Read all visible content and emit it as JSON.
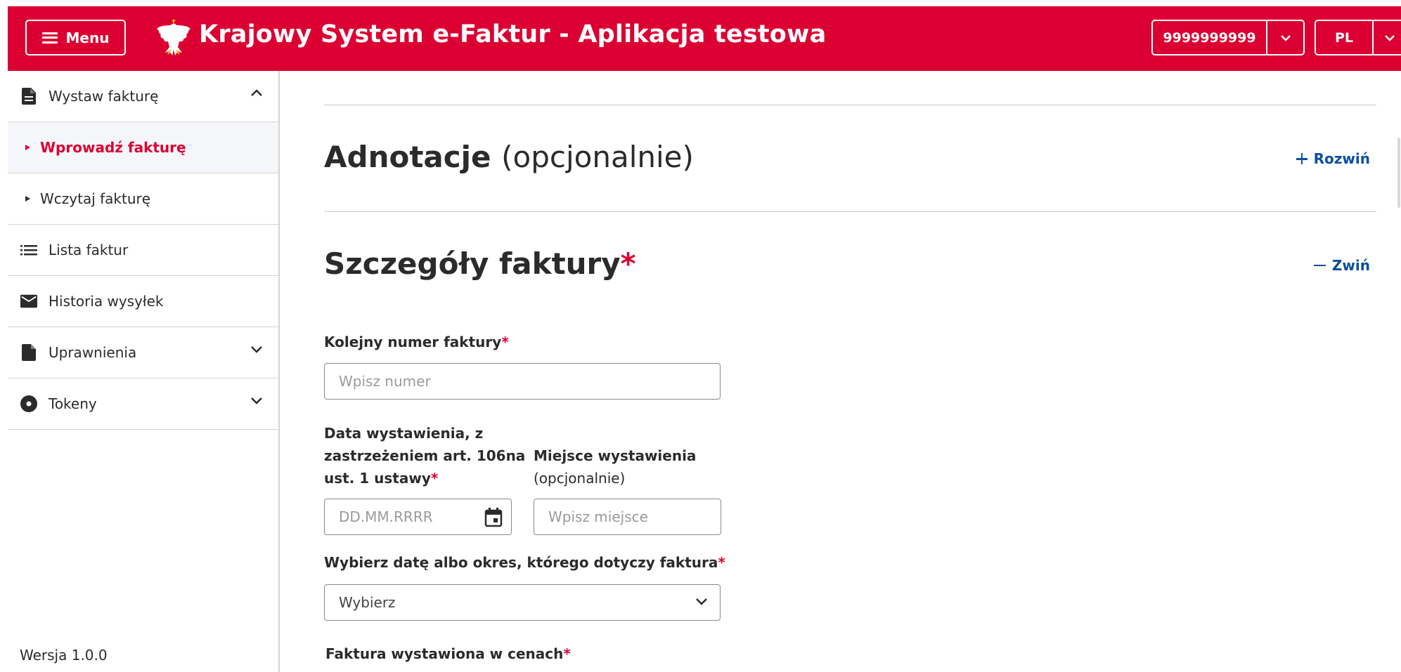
{
  "header": {
    "menu_label": "Menu",
    "title": "Krajowy System e-Faktur - Aplikacja testowa",
    "nip": "9999999999",
    "language": "PL",
    "brand_color": "#dc0032"
  },
  "sidebar": {
    "items": [
      {
        "label": "Wystaw fakturę",
        "icon": "document-icon",
        "expanded": true
      },
      {
        "label": "Wprowadź fakturę",
        "active": true
      },
      {
        "label": "Wczytaj fakturę"
      },
      {
        "label": "Lista faktur",
        "icon": "list-icon"
      },
      {
        "label": "Historia wysyłek",
        "icon": "envelope-icon"
      },
      {
        "label": "Uprawnienia",
        "icon": "file-icon",
        "expanded": false
      },
      {
        "label": "Tokeny",
        "icon": "disc-icon",
        "expanded": false
      }
    ],
    "version": "Wersja 1.0.0"
  },
  "main": {
    "adnotacje": {
      "title": "Adnotacje",
      "optional": "(opcjonalnie)",
      "toggle": "Rozwiń"
    },
    "szczegoly": {
      "title": "Szczegóły faktury",
      "required_mark": "*",
      "toggle": "Zwiń"
    },
    "fields": {
      "numer_label": "Kolejny numer faktury",
      "numer_placeholder": "Wpisz numer",
      "data_label_1": "Data wystawienia, z",
      "data_label_2": "zastrzeżeniem art. 106na",
      "data_label_3": "ust. 1 ustawy",
      "data_placeholder": "DD.MM.RRRR",
      "miejsce_label": "Miejsce wystawienia",
      "miejsce_optional": "(opcjonalnie)",
      "miejsce_placeholder": "Wpisz miejsce",
      "okres_label": "Wybierz datę albo okres, którego dotyczy faktura",
      "okres_value": "Wybierz",
      "ceny_label": "Faktura wystawiona w cenach"
    },
    "link_color": "#0a4fa0"
  }
}
